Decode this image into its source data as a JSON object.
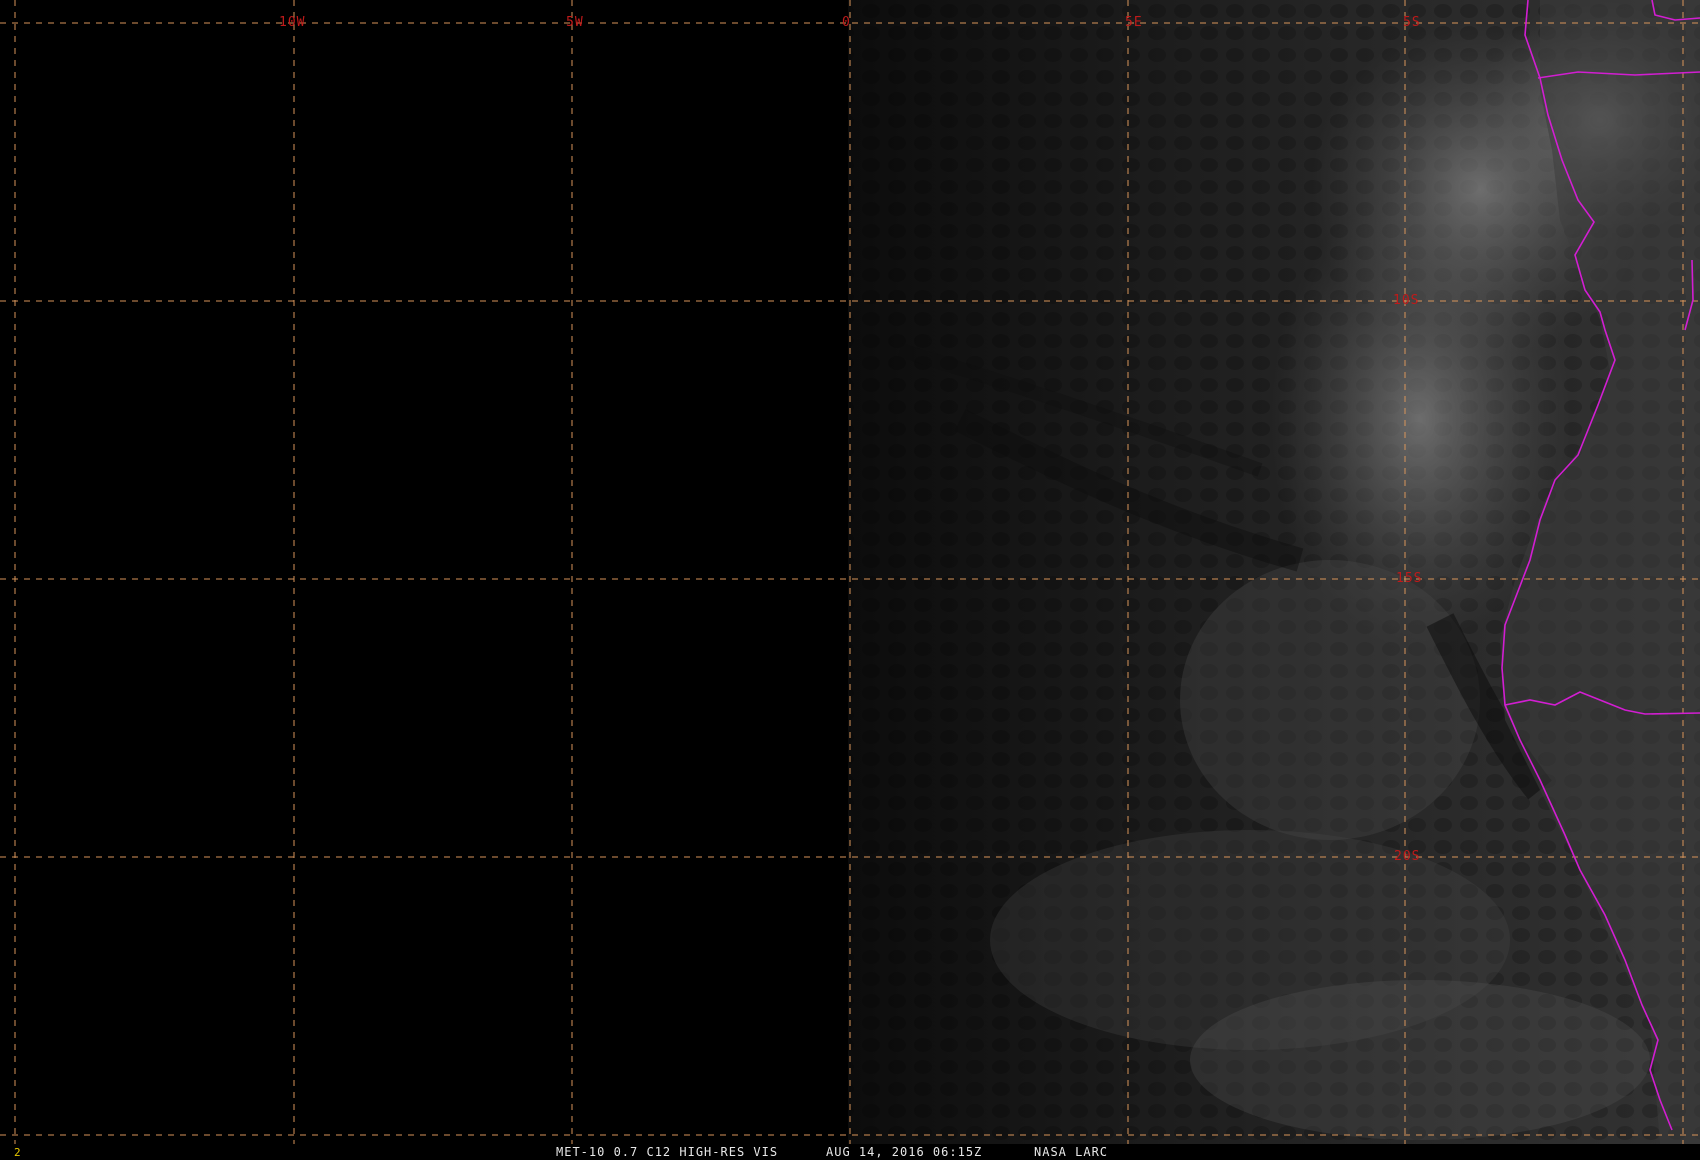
{
  "map": {
    "projection_grid_interval_deg": 5,
    "longitude_labels": [
      "10W",
      "5W",
      "0",
      "5E",
      "5S"
    ],
    "latitude_labels": [
      "10S",
      "15S",
      "20S"
    ],
    "colors": {
      "grid_line": "#d8955a",
      "grid_label": "#c01a1a",
      "boundary": "#d21ed2",
      "background": "#000000"
    },
    "imagery": {
      "type": "visible satellite image",
      "night_region": "left half (west of 0)",
      "features": [
        "marine stratocumulus cloud field",
        "southwest African coastline",
        "country borders"
      ]
    }
  },
  "footer": {
    "frame_index": "2",
    "product": "MET-10 0.7 C12 HIGH-RES VIS",
    "datetime": "AUG 14, 2016 06:15Z",
    "source": "NASA LARC"
  }
}
